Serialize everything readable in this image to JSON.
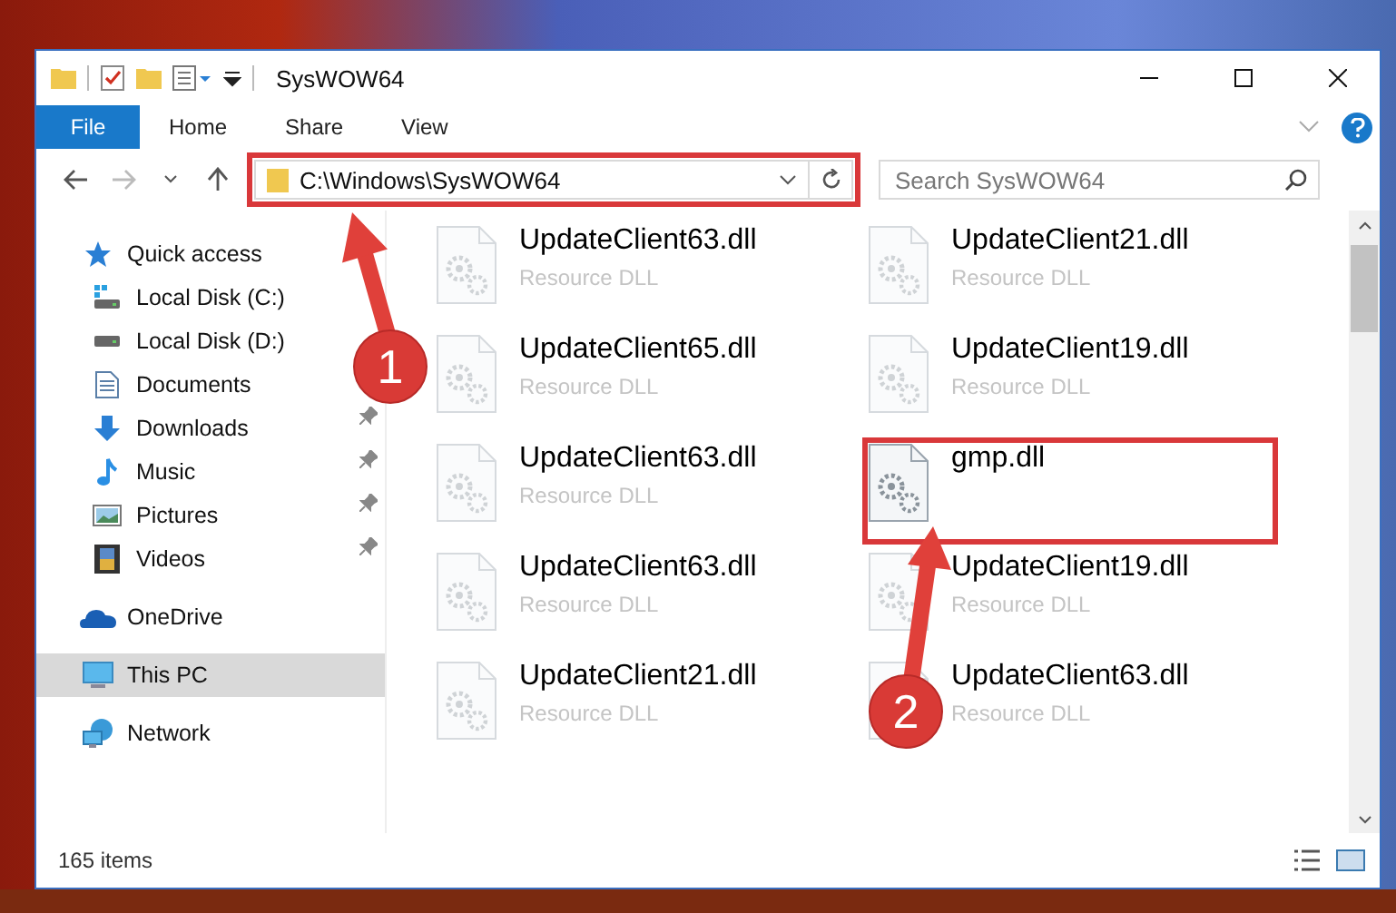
{
  "window": {
    "title": "SysWOW64"
  },
  "ribbon": {
    "tabs": [
      {
        "label": "File",
        "kind": "file"
      },
      {
        "label": "Home",
        "kind": "tab"
      },
      {
        "label": "Share",
        "kind": "tab"
      },
      {
        "label": "View",
        "kind": "tab"
      }
    ]
  },
  "address_bar": {
    "path": "C:\\Windows\\SysWOW64",
    "highlighted": true
  },
  "search": {
    "placeholder": "Search SysWOW64"
  },
  "sidebar": {
    "items": [
      {
        "label": "Quick access",
        "kind": "star",
        "selected": false,
        "children": [
          {
            "label": "Local Disk (C:)",
            "kind": "system-drive",
            "pinned": false,
            "selected": false
          },
          {
            "label": "Local Disk (D:)",
            "kind": "drive",
            "pinned": false,
            "selected": false
          },
          {
            "label": "Documents",
            "kind": "documents",
            "pinned": false,
            "selected": false
          },
          {
            "label": "Downloads",
            "kind": "downloads",
            "pinned": true,
            "selected": false
          },
          {
            "label": "Music",
            "kind": "music",
            "pinned": true,
            "selected": false
          },
          {
            "label": "Pictures",
            "kind": "pictures",
            "pinned": true,
            "selected": false
          },
          {
            "label": "Videos",
            "kind": "videos",
            "pinned": true,
            "selected": false
          }
        ]
      },
      {
        "label": "OneDrive",
        "kind": "cloud",
        "selected": false
      },
      {
        "label": "This PC",
        "kind": "pc",
        "selected": true
      },
      {
        "label": "Network",
        "kind": "network",
        "selected": false
      }
    ]
  },
  "files": [
    {
      "name": "UpdateClient63.dll",
      "type": "Resource DLL",
      "faded": true,
      "highlighted": false
    },
    {
      "name": "UpdateClient21.dll",
      "type": "Resource DLL",
      "faded": true,
      "highlighted": false
    },
    {
      "name": "UpdateClient65.dll",
      "type": "Resource DLL",
      "faded": true,
      "highlighted": false
    },
    {
      "name": "UpdateClient19.dll",
      "type": "Resource DLL",
      "faded": true,
      "highlighted": false
    },
    {
      "name": "UpdateClient63.dll",
      "type": "Resource DLL",
      "faded": true,
      "highlighted": false
    },
    {
      "name": "gmp.dll",
      "faded": false,
      "highlighted": true
    },
    {
      "name": "UpdateClient63.dll",
      "type": "Resource DLL",
      "faded": true,
      "highlighted": false
    },
    {
      "name": "UpdateClient19.dll",
      "type": "Resource DLL",
      "faded": true,
      "highlighted": false
    },
    {
      "name": "UpdateClient21.dll",
      "type": "Resource DLL",
      "faded": true,
      "highlighted": false
    },
    {
      "name": "UpdateClient63.dll",
      "type": "Resource DLL",
      "faded": true,
      "highlighted": false
    }
  ],
  "status_bar": {
    "item_count": "165 items"
  },
  "steps": [
    {
      "number": "1"
    },
    {
      "number": "2"
    }
  ]
}
